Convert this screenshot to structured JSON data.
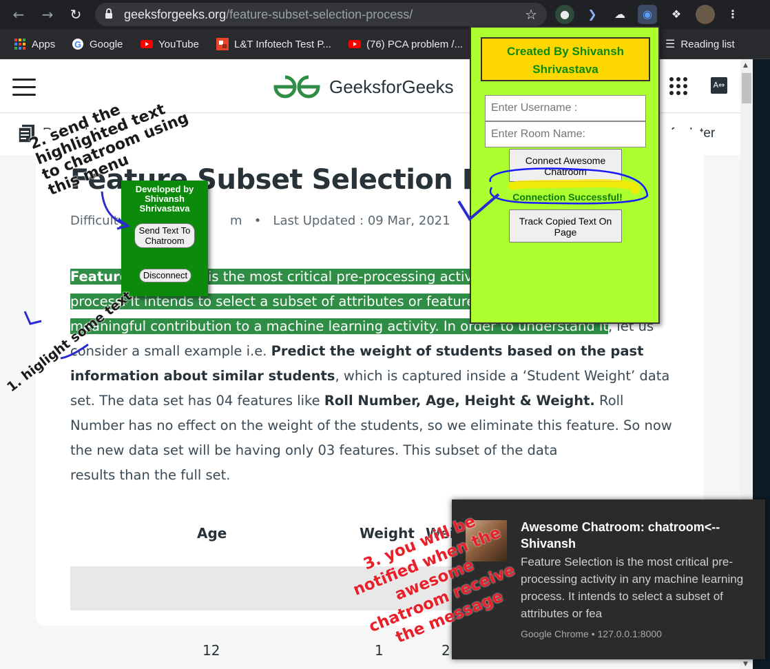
{
  "browser": {
    "url_host": "geeksforgeeks.org",
    "url_path": "/feature-subset-selection-process/"
  },
  "bookmarks": [
    {
      "label": "Apps",
      "icon": "apps-grid-icon"
    },
    {
      "label": "Google",
      "icon": "google-icon"
    },
    {
      "label": "YouTube",
      "icon": "youtube-icon"
    },
    {
      "label": "L&T Infotech Test P...",
      "icon": "lti-icon"
    },
    {
      "label": "(76) PCA problem /...",
      "icon": "youtube-icon"
    }
  ],
  "reading_list": "Reading list",
  "site": {
    "logo_text": "GeeksforGeeks",
    "related": "Related Articles",
    "save_later": "e for later"
  },
  "article": {
    "title": "Feature Subset Selection Proce",
    "difficulty": "Difficulty",
    "difficulty_suffix": "m",
    "updated": "Last Updated : 09 Mar, 2021",
    "p_hl_bold": "Feature Selection",
    "p_hl_text": " is the most critical pre-processing activity in any machine learning process. It intends to select a subset of attributes or features that makes the most meaningful contribution to a machine learning activity. In order to understand it",
    "p_text1": ", let us consider a small example i.e. ",
    "p_bold1": "Predict the weight of students based on the past information about similar students",
    "p_text2": ", which is captured inside a ‘Student Weight’ data set. The data set has 04 features like ",
    "p_bold2": "Roll Number, Age, Height & Weight.",
    "p_text3": " Roll Number has no effect on the weight of the students, so we eliminate this feature. So now the new data set will be having only 03 features. This subset of the data",
    "p_text4": "results than the full set.",
    "table_headers": [
      "Age",
      "Weight",
      "Wei"
    ],
    "table_row1": [
      "12",
      "1",
      "2"
    ]
  },
  "context_menu": {
    "title": "Developed by Shivansh Shrivastava",
    "send_btn": "Send Text To Chatroom",
    "disconnect_btn": "Disconnect"
  },
  "popup": {
    "banner": "Created By Shivansh Shrivastava",
    "username_placeholder": "Enter Username :",
    "room_placeholder": "Enter Room Name:",
    "connect_btn": "Connect Awesome Chatroom",
    "status": "Connection Successful!",
    "track_btn": "Track Copied Text On Page",
    "bg_color": "#adff2f",
    "banner_color": "#ffd700"
  },
  "notification": {
    "title": "Awesome Chatroom: chatroom<--Shivansh",
    "body": "Feature Selection is the most critical pre-processing activity in any machine learning process. It intends to select a subset of attributes or fea",
    "source": "Google Chrome • 127.0.0.1:8000"
  },
  "annotations": {
    "step1": "1. higlight some text",
    "step2": "2. send the highlighted text to chatroom using this menu",
    "step3": "3. you will be notified when the awesome chatroom receive the message"
  },
  "colors": {
    "gfg_green": "#2f8d46",
    "menu_green": "#0b8a0b",
    "annotation_red": "#e8202a"
  }
}
